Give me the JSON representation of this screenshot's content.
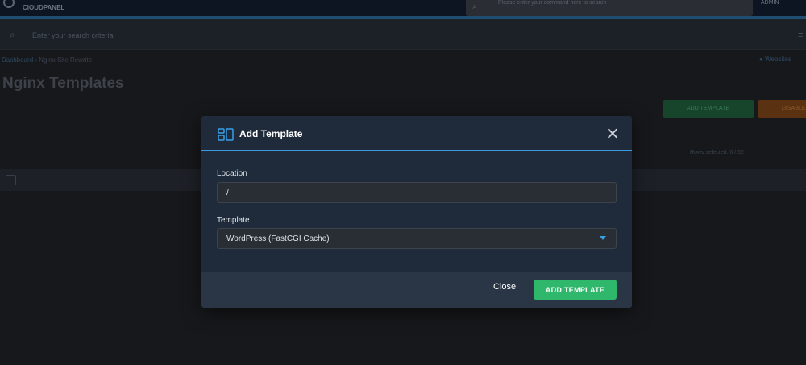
{
  "background": {
    "brand": "ClOUDPANEL",
    "top_search_placeholder": "Please enter your command here to search",
    "user_label": "ADMIN",
    "search_placeholder": "Enter your search criteria",
    "breadcrumb_home": "Dashboard",
    "breadcrumb_current": "Nginx Site Rewrite",
    "help_label": "Websites",
    "page_title": "Nginx Templates",
    "add_button": "ADD TEMPLATE",
    "second_button": "DISABLE",
    "rows_selected": "Rows selected: 0 / 52"
  },
  "modal": {
    "title": "Add Template",
    "location_label": "Location",
    "location_value": "/",
    "template_label": "Template",
    "template_value": "WordPress (FastCGI Cache)",
    "close_label": "Close",
    "submit_label": "ADD TEMPLATE"
  },
  "colors": {
    "accent_blue": "#3a9ae0",
    "primary_green": "#2fb86b",
    "modal_bg": "#1f2b3a"
  },
  "icons": {
    "header": "templates-icon",
    "close": "close-icon",
    "dropdown": "chevron-down-icon"
  }
}
